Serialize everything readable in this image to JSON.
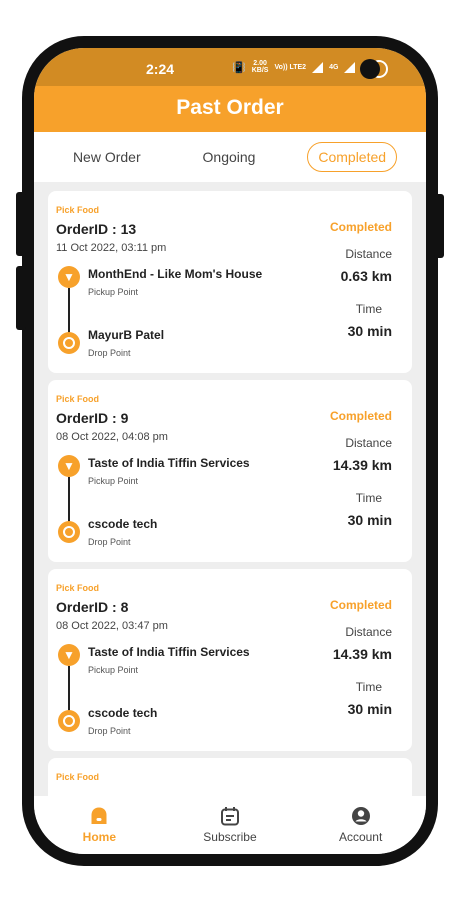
{
  "status_bar": {
    "time": "2:24",
    "speed": "2.00",
    "speed_unit": "KB/S",
    "network": "Vo)) LTE2",
    "signal_label": "4G",
    "battery": "69"
  },
  "header": {
    "title": "Past Order"
  },
  "tabs": [
    {
      "label": "New Order",
      "active": false
    },
    {
      "label": "Ongoing",
      "active": false
    },
    {
      "label": "Completed",
      "active": true
    }
  ],
  "labels": {
    "distance": "Distance",
    "time": "Time",
    "pickup_point": "Pickup Point",
    "drop_point": "Drop Point"
  },
  "orders": [
    {
      "category": "Pick Food",
      "order_id": "OrderID : 13",
      "date": "11 Oct 2022, 03:11 pm",
      "status": "Completed",
      "pickup_name": "MonthEnd - Like Mom's House",
      "drop_name": "MayurB Patel",
      "distance": "0.63 km",
      "time": "30 min"
    },
    {
      "category": "Pick Food",
      "order_id": "OrderID : 9",
      "date": "08 Oct 2022, 04:08 pm",
      "status": "Completed",
      "pickup_name": "Taste of India Tiffin Services",
      "drop_name": "cscode tech",
      "distance": "14.39 km",
      "time": "30 min"
    },
    {
      "category": "Pick Food",
      "order_id": "OrderID : 8",
      "date": "08 Oct 2022, 03:47 pm",
      "status": "Completed",
      "pickup_name": "Taste of India Tiffin Services",
      "drop_name": "cscode tech",
      "distance": "14.39 km",
      "time": "30 min"
    },
    {
      "category": "Pick Food"
    }
  ],
  "bottom_nav": [
    {
      "label": "Home",
      "icon": "home-icon",
      "active": true
    },
    {
      "label": "Subscribe",
      "icon": "calendar-icon",
      "active": false
    },
    {
      "label": "Account",
      "icon": "account-icon",
      "active": false
    }
  ],
  "colors": {
    "accent": "#f7a12b",
    "status_bar": "#d28b23",
    "background": "#eeeeee",
    "card": "#ffffff"
  }
}
